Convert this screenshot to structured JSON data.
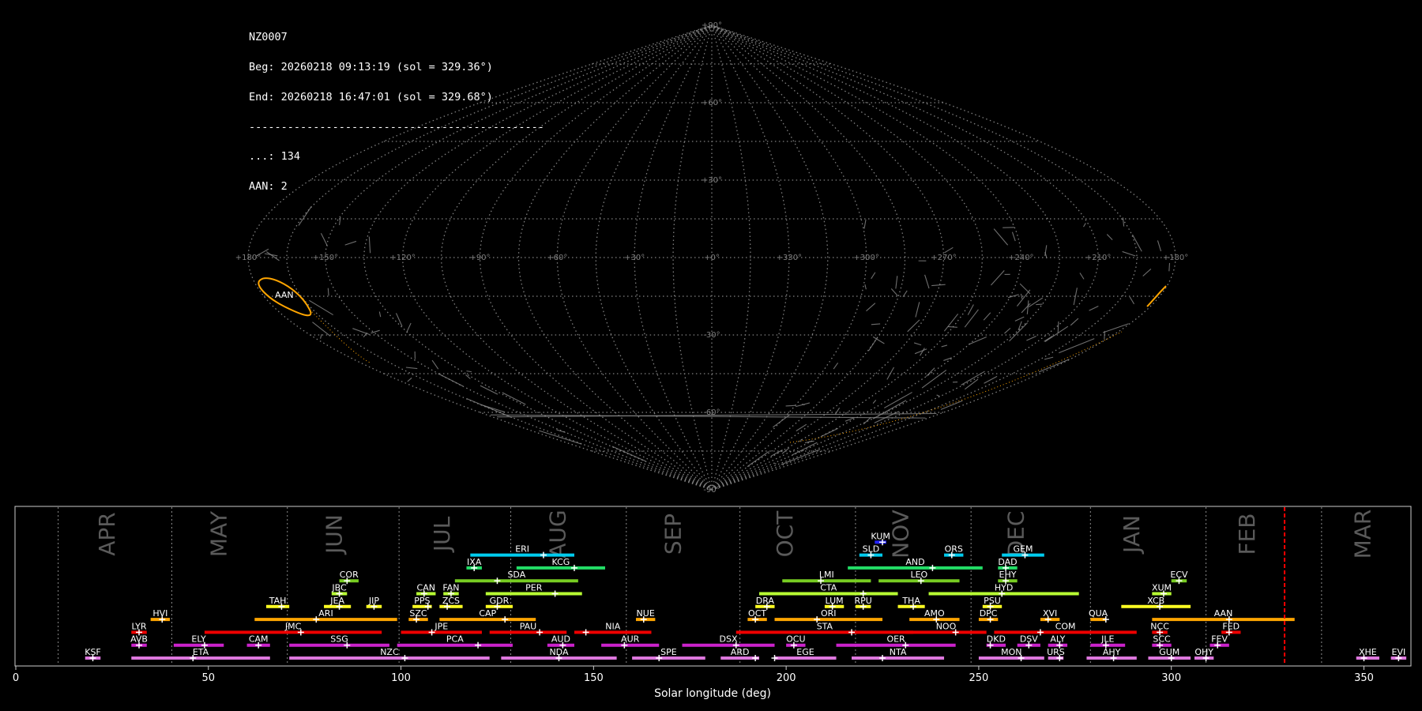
{
  "info": {
    "station": "NZ0007",
    "begin": "Beg: 20260218 09:13:19 (sol = 329.36°)",
    "end": "End: 20260218 16:47:01 (sol = 329.68°)",
    "separator": "----------------------------------------------",
    "sporadic": "...: 134",
    "aan": "AAN: 2"
  },
  "colors": {
    "background": "#000000",
    "grid": "#7f7f7f",
    "sporadic": "#8a8a8a",
    "aan": "#ffa500",
    "current_sol": "#ff0000",
    "month_label": "#5a5a5a"
  },
  "chart_data": [
    {
      "type": "sky-map",
      "projection": "sinusoidal",
      "grid": true,
      "lon_ticks": [
        "+180°",
        "+150°",
        "+120°",
        "+90°",
        "+60°",
        "+30°",
        "+0°",
        "+330°",
        "+300°",
        "+270°",
        "+240°",
        "+210°",
        "+180°"
      ],
      "lat_ticks": [
        "+90°",
        "+60°",
        "+30°",
        "-30°",
        "-60°",
        "-90°"
      ],
      "annotations": [
        {
          "text": "AAN",
          "lon": 175,
          "lat": -15
        }
      ]
    },
    {
      "type": "timeline",
      "xlabel": "Solar longitude (deg)",
      "xlim": [
        0,
        362
      ],
      "xticks": [
        0,
        50,
        100,
        150,
        200,
        250,
        300,
        350
      ],
      "current_sol": 329.4,
      "months": [
        {
          "label": "APR",
          "x": 24
        },
        {
          "label": "MAY",
          "x": 53
        },
        {
          "label": "JUN",
          "x": 83
        },
        {
          "label": "JUL",
          "x": 111
        },
        {
          "label": "AUG",
          "x": 141
        },
        {
          "label": "SEP",
          "x": 171
        },
        {
          "label": "OCT",
          "x": 200
        },
        {
          "label": "NOV",
          "x": 230
        },
        {
          "label": "DEC",
          "x": 260
        },
        {
          "label": "JAN",
          "x": 290
        },
        {
          "label": "FEB",
          "x": 320
        },
        {
          "label": "MAR",
          "x": 350
        }
      ],
      "month_dividers": [
        11,
        40.5,
        70.5,
        99.5,
        128.5,
        158.5,
        188,
        218,
        248,
        279,
        309,
        339
      ],
      "row_colors": [
        "#dd77dd",
        "#cc22cc",
        "#ee0000",
        "#ffa500",
        "#ffff22",
        "#b8ff33",
        "#77cc22",
        "#22dd66",
        "#00ccee",
        "#2222ff"
      ],
      "showers": [
        {
          "code": "KSF",
          "row": 0,
          "start": 18,
          "end": 22,
          "peak": 20
        },
        {
          "code": "ETA",
          "row": 0,
          "start": 30,
          "end": 66,
          "peak": 46
        },
        {
          "code": "NZC",
          "row": 0,
          "start": 71,
          "end": 123,
          "peak": 101
        },
        {
          "code": "NDA",
          "row": 0,
          "start": 126,
          "end": 156,
          "peak": 141
        },
        {
          "code": "SPE",
          "row": 0,
          "start": 160,
          "end": 179,
          "peak": 167
        },
        {
          "code": "ARD",
          "row": 0,
          "start": 183,
          "end": 193,
          "peak": 192
        },
        {
          "code": "EGE",
          "row": 0,
          "start": 197,
          "end": 213,
          "peak": 197
        },
        {
          "code": "NTA",
          "row": 0,
          "start": 217,
          "end": 241,
          "peak": 225
        },
        {
          "code": "MON",
          "row": 0,
          "start": 250,
          "end": 267,
          "peak": 261
        },
        {
          "code": "URS",
          "row": 0,
          "start": 268,
          "end": 272,
          "peak": 271
        },
        {
          "code": "AHY",
          "row": 0,
          "start": 278,
          "end": 291,
          "peak": 285
        },
        {
          "code": "GUM",
          "row": 0,
          "start": 294,
          "end": 305,
          "peak": 300
        },
        {
          "code": "OHY",
          "row": 0,
          "start": 306,
          "end": 311,
          "peak": 309
        },
        {
          "code": "XHE",
          "row": 0,
          "start": 348,
          "end": 354,
          "peak": 350
        },
        {
          "code": "EVI",
          "row": 0,
          "start": 357,
          "end": 361,
          "peak": 359
        },
        {
          "code": "AVB",
          "row": 1,
          "start": 30,
          "end": 34,
          "peak": 32
        },
        {
          "code": "ELY",
          "row": 1,
          "start": 41,
          "end": 54,
          "peak": 49
        },
        {
          "code": "CAM",
          "row": 1,
          "start": 60,
          "end": 66,
          "peak": 63
        },
        {
          "code": "SSG",
          "row": 1,
          "start": 71,
          "end": 97,
          "peak": 86
        },
        {
          "code": "PCA",
          "row": 1,
          "start": 99,
          "end": 129,
          "peak": 120
        },
        {
          "code": "AUD",
          "row": 1,
          "start": 138,
          "end": 145,
          "peak": 142
        },
        {
          "code": "AUR",
          "row": 1,
          "start": 152,
          "end": 167,
          "peak": 158
        },
        {
          "code": "DSX",
          "row": 1,
          "start": 173,
          "end": 197,
          "peak": 187
        },
        {
          "code": "OCU",
          "row": 1,
          "start": 200,
          "end": 205,
          "peak": 202
        },
        {
          "code": "OER",
          "row": 1,
          "start": 213,
          "end": 244,
          "peak": 231
        },
        {
          "code": "DKD",
          "row": 1,
          "start": 252,
          "end": 257,
          "peak": 253
        },
        {
          "code": "DSV",
          "row": 1,
          "start": 260,
          "end": 266,
          "peak": 263
        },
        {
          "code": "ALY",
          "row": 1,
          "start": 268,
          "end": 273,
          "peak": 271
        },
        {
          "code": "JLE",
          "row": 1,
          "start": 279,
          "end": 288,
          "peak": 283
        },
        {
          "code": "SCC",
          "row": 1,
          "start": 295,
          "end": 300,
          "peak": 297
        },
        {
          "code": "FEV",
          "row": 1,
          "start": 310,
          "end": 315,
          "peak": 312
        },
        {
          "code": "LYR",
          "row": 2,
          "start": 30,
          "end": 34,
          "peak": 32
        },
        {
          "code": "JMC",
          "row": 2,
          "start": 49,
          "end": 95,
          "peak": 74
        },
        {
          "code": "JPE",
          "row": 2,
          "start": 100,
          "end": 121,
          "peak": 108
        },
        {
          "code": "PAU",
          "row": 2,
          "start": 123,
          "end": 143,
          "peak": 136
        },
        {
          "code": "NIA",
          "row": 2,
          "start": 145,
          "end": 165,
          "peak": 148
        },
        {
          "code": "STA",
          "row": 2,
          "start": 187,
          "end": 233,
          "peak": 217
        },
        {
          "code": "NOO",
          "row": 2,
          "start": 231,
          "end": 252,
          "peak": 244
        },
        {
          "code": "COM",
          "row": 2,
          "start": 254,
          "end": 291,
          "peak": 266
        },
        {
          "code": "NCC",
          "row": 2,
          "start": 295,
          "end": 299,
          "peak": 297
        },
        {
          "code": "FED",
          "row": 2,
          "start": 313,
          "end": 318,
          "peak": 315
        },
        {
          "code": "HVI",
          "row": 3,
          "start": 35,
          "end": 40,
          "peak": 38
        },
        {
          "code": "ARI",
          "row": 3,
          "start": 62,
          "end": 99,
          "peak": 78
        },
        {
          "code": "SZC",
          "row": 3,
          "start": 102,
          "end": 107,
          "peak": 104
        },
        {
          "code": "CAP",
          "row": 3,
          "start": 110,
          "end": 135,
          "peak": 127
        },
        {
          "code": "NUE",
          "row": 3,
          "start": 161,
          "end": 166,
          "peak": 163
        },
        {
          "code": "OCT",
          "row": 3,
          "start": 190,
          "end": 195,
          "peak": 192
        },
        {
          "code": "ORI",
          "row": 3,
          "start": 197,
          "end": 225,
          "peak": 208
        },
        {
          "code": "AMO",
          "row": 3,
          "start": 232,
          "end": 245,
          "peak": 239
        },
        {
          "code": "DPC",
          "row": 3,
          "start": 250,
          "end": 255,
          "peak": 253
        },
        {
          "code": "XVI",
          "row": 3,
          "start": 266,
          "end": 271,
          "peak": 268
        },
        {
          "code": "QUA",
          "row": 3,
          "start": 279,
          "end": 283,
          "peak": 283
        },
        {
          "code": "AAN",
          "row": 3,
          "start": 295,
          "end": 332,
          "peak": 315
        },
        {
          "code": "TAH",
          "row": 4,
          "start": 65,
          "end": 71,
          "peak": 69
        },
        {
          "code": "JEA",
          "row": 4,
          "start": 80,
          "end": 87,
          "peak": 84
        },
        {
          "code": "JIP",
          "row": 4,
          "start": 91,
          "end": 95,
          "peak": 93
        },
        {
          "code": "PPS",
          "row": 4,
          "start": 103,
          "end": 108,
          "peak": 107
        },
        {
          "code": "ZCS",
          "row": 4,
          "start": 110,
          "end": 116,
          "peak": 112
        },
        {
          "code": "GDR",
          "row": 4,
          "start": 122,
          "end": 129,
          "peak": 125
        },
        {
          "code": "DRA",
          "row": 4,
          "start": 192,
          "end": 197,
          "peak": 195
        },
        {
          "code": "LUM",
          "row": 4,
          "start": 210,
          "end": 215,
          "peak": 212
        },
        {
          "code": "RPU",
          "row": 4,
          "start": 218,
          "end": 222,
          "peak": 220
        },
        {
          "code": "THA",
          "row": 4,
          "start": 229,
          "end": 236,
          "peak": 233
        },
        {
          "code": "PSU",
          "row": 4,
          "start": 251,
          "end": 256,
          "peak": 253
        },
        {
          "code": "XCB",
          "row": 4,
          "start": 287,
          "end": 305,
          "peak": 297
        },
        {
          "code": "JBC",
          "row": 5,
          "start": 82,
          "end": 86,
          "peak": 84
        },
        {
          "code": "CAN",
          "row": 5,
          "start": 104,
          "end": 109,
          "peak": 106
        },
        {
          "code": "FAN",
          "row": 5,
          "start": 111,
          "end": 115,
          "peak": 113
        },
        {
          "code": "PER",
          "row": 5,
          "start": 122,
          "end": 147,
          "peak": 140
        },
        {
          "code": "CTA",
          "row": 5,
          "start": 193,
          "end": 229,
          "peak": 220
        },
        {
          "code": "HYD",
          "row": 5,
          "start": 237,
          "end": 276,
          "peak": 256
        },
        {
          "code": "XUM",
          "row": 5,
          "start": 295,
          "end": 300,
          "peak": 298
        },
        {
          "code": "COR",
          "row": 6,
          "start": 84,
          "end": 89,
          "peak": 86
        },
        {
          "code": "SDA",
          "row": 6,
          "start": 114,
          "end": 146,
          "peak": 125
        },
        {
          "code": "LMI",
          "row": 6,
          "start": 199,
          "end": 222,
          "peak": 209
        },
        {
          "code": "LEO",
          "row": 6,
          "start": 224,
          "end": 245,
          "peak": 235
        },
        {
          "code": "EHY",
          "row": 6,
          "start": 255,
          "end": 260,
          "peak": 257
        },
        {
          "code": "ECV",
          "row": 6,
          "start": 300,
          "end": 304,
          "peak": 302
        },
        {
          "code": "IXA",
          "row": 7,
          "start": 117,
          "end": 121,
          "peak": 119
        },
        {
          "code": "KCG",
          "row": 7,
          "start": 130,
          "end": 153,
          "peak": 145
        },
        {
          "code": "AND",
          "row": 7,
          "start": 216,
          "end": 251,
          "peak": 238
        },
        {
          "code": "DAD",
          "row": 7,
          "start": 255,
          "end": 260,
          "peak": 257
        },
        {
          "code": "ERI",
          "row": 8,
          "start": 118,
          "end": 145,
          "peak": 137
        },
        {
          "code": "SLD",
          "row": 8,
          "start": 219,
          "end": 225,
          "peak": 222
        },
        {
          "code": "ORS",
          "row": 8,
          "start": 241,
          "end": 246,
          "peak": 243
        },
        {
          "code": "GEM",
          "row": 8,
          "start": 256,
          "end": 267,
          "peak": 262
        },
        {
          "code": "KUM",
          "row": 9,
          "start": 223,
          "end": 226,
          "peak": 225
        }
      ]
    }
  ]
}
